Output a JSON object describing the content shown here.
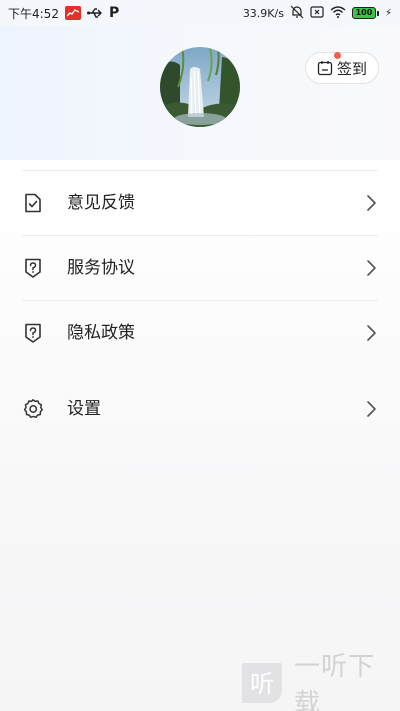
{
  "status_bar": {
    "time": "下午4:52",
    "p_label": "P",
    "net_speed": "33.9K/s",
    "battery": "100"
  },
  "header": {
    "checkin_label": "签到"
  },
  "menu": {
    "items": [
      {
        "label": "意见反馈",
        "icon": "feedback-icon"
      },
      {
        "label": "服务协议",
        "icon": "service-agreement-icon"
      },
      {
        "label": "隐私政策",
        "icon": "privacy-policy-icon"
      },
      {
        "label": "设置",
        "icon": "gear-icon"
      }
    ]
  },
  "watermark": {
    "logo": "听",
    "text": "一听下载"
  },
  "colors": {
    "accent_dot": "#f25f4c",
    "battery_green": "#3cc24a"
  }
}
